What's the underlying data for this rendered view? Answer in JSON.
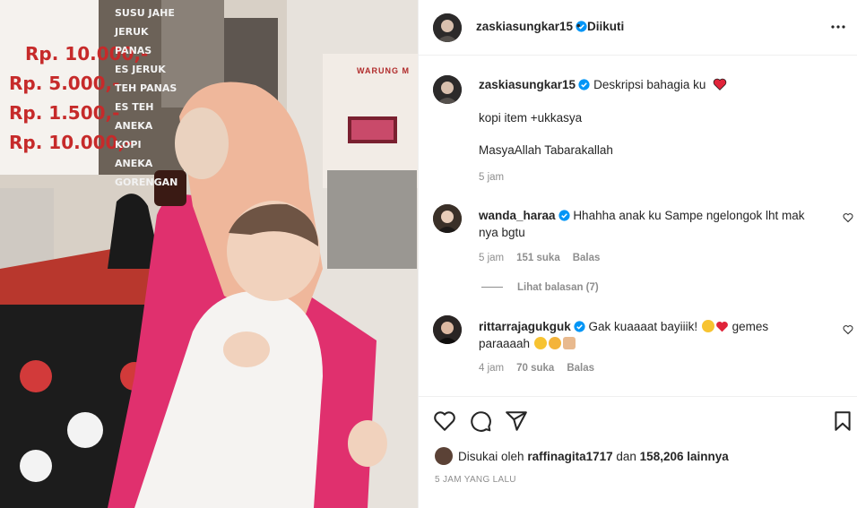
{
  "post": {
    "author": "zaskiasungkar15",
    "follow_status": "Diikuti",
    "dot": "•",
    "caption_text": "Deskripsi bahagia ku",
    "caption_line2": "kopi item +ukkasya",
    "caption_line3": "MasyaAllah Tabarakallah",
    "caption_time": "5 jam"
  },
  "photo_sign": {
    "prices": [
      "Rp. 10.000,-",
      "Rp. 5.000,-",
      "Rp. 1.500,-",
      "Rp. 10.000,-"
    ],
    "menu": [
      "SUSU JAHE",
      "JERUK PANAS",
      "ES JERUK",
      "TEH PANAS",
      "ES TEH",
      "ANEKA KOPI",
      "ANEKA GORENGAN"
    ],
    "shop_sign": "WARUNG M"
  },
  "comments": [
    {
      "user": "wanda_haraa",
      "text": "Hhahha anak ku Sampe ngelongok lht mak nya bgtu",
      "time": "5 jam",
      "likes": "151 suka",
      "reply": "Balas",
      "view_replies": "Lihat balasan (7)"
    },
    {
      "user": "rittarrajagukguk",
      "text_a": "Gak kuaaaat bayiiik!",
      "text_b": "gemes paraaaah",
      "time": "4 jam",
      "likes": "70 suka",
      "reply": "Balas"
    }
  ],
  "likes_summary": {
    "prefix": "Disukai oleh",
    "user": "raffinagita1717",
    "mid": "dan",
    "count": "158,206 lainnya"
  },
  "posted_ago": "5 JAM YANG LALU",
  "icons": [
    "verified-badge-icon",
    "more-options-icon",
    "heart-icon",
    "comment-icon",
    "share-icon",
    "bookmark-icon"
  ],
  "colors": {
    "verified": "#0095f6",
    "heart": "#ed4956",
    "muted": "#8e8e8e",
    "text": "#262626"
  }
}
